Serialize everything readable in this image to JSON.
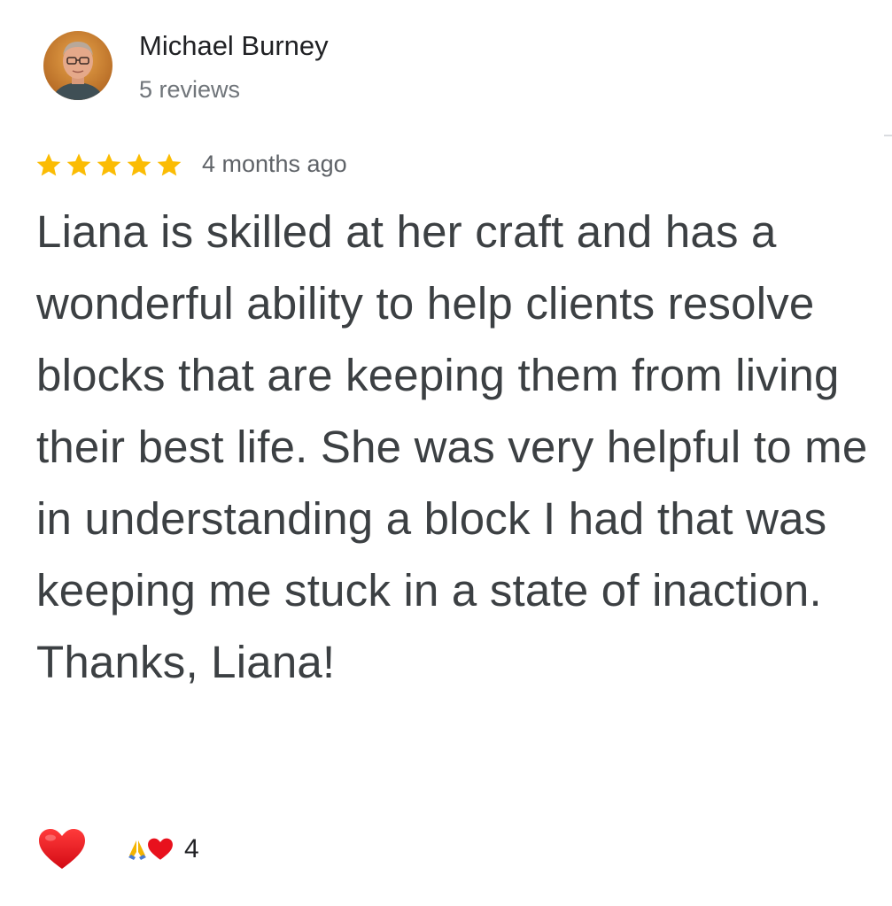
{
  "reviewer": {
    "name": "Michael Burney",
    "meta": "5 reviews"
  },
  "review": {
    "rating": 5,
    "rating_max": 5,
    "time": "4 months ago",
    "text": "Liana is skilled at her craft and has a wonderful ability to help clients resolve blocks that are keeping them from living their best life. She was very helpful to me in understanding a block I had that was keeping me stuck in a state of inaction. Thanks, Liana!"
  },
  "reactions": {
    "count": "4",
    "icons": [
      "pray-icon",
      "heart-icon"
    ]
  },
  "colors": {
    "star": "#fbbc04",
    "heart": "#e8111d",
    "text_primary": "#202124",
    "text_body": "#3c4043",
    "text_secondary": "#70757a"
  }
}
